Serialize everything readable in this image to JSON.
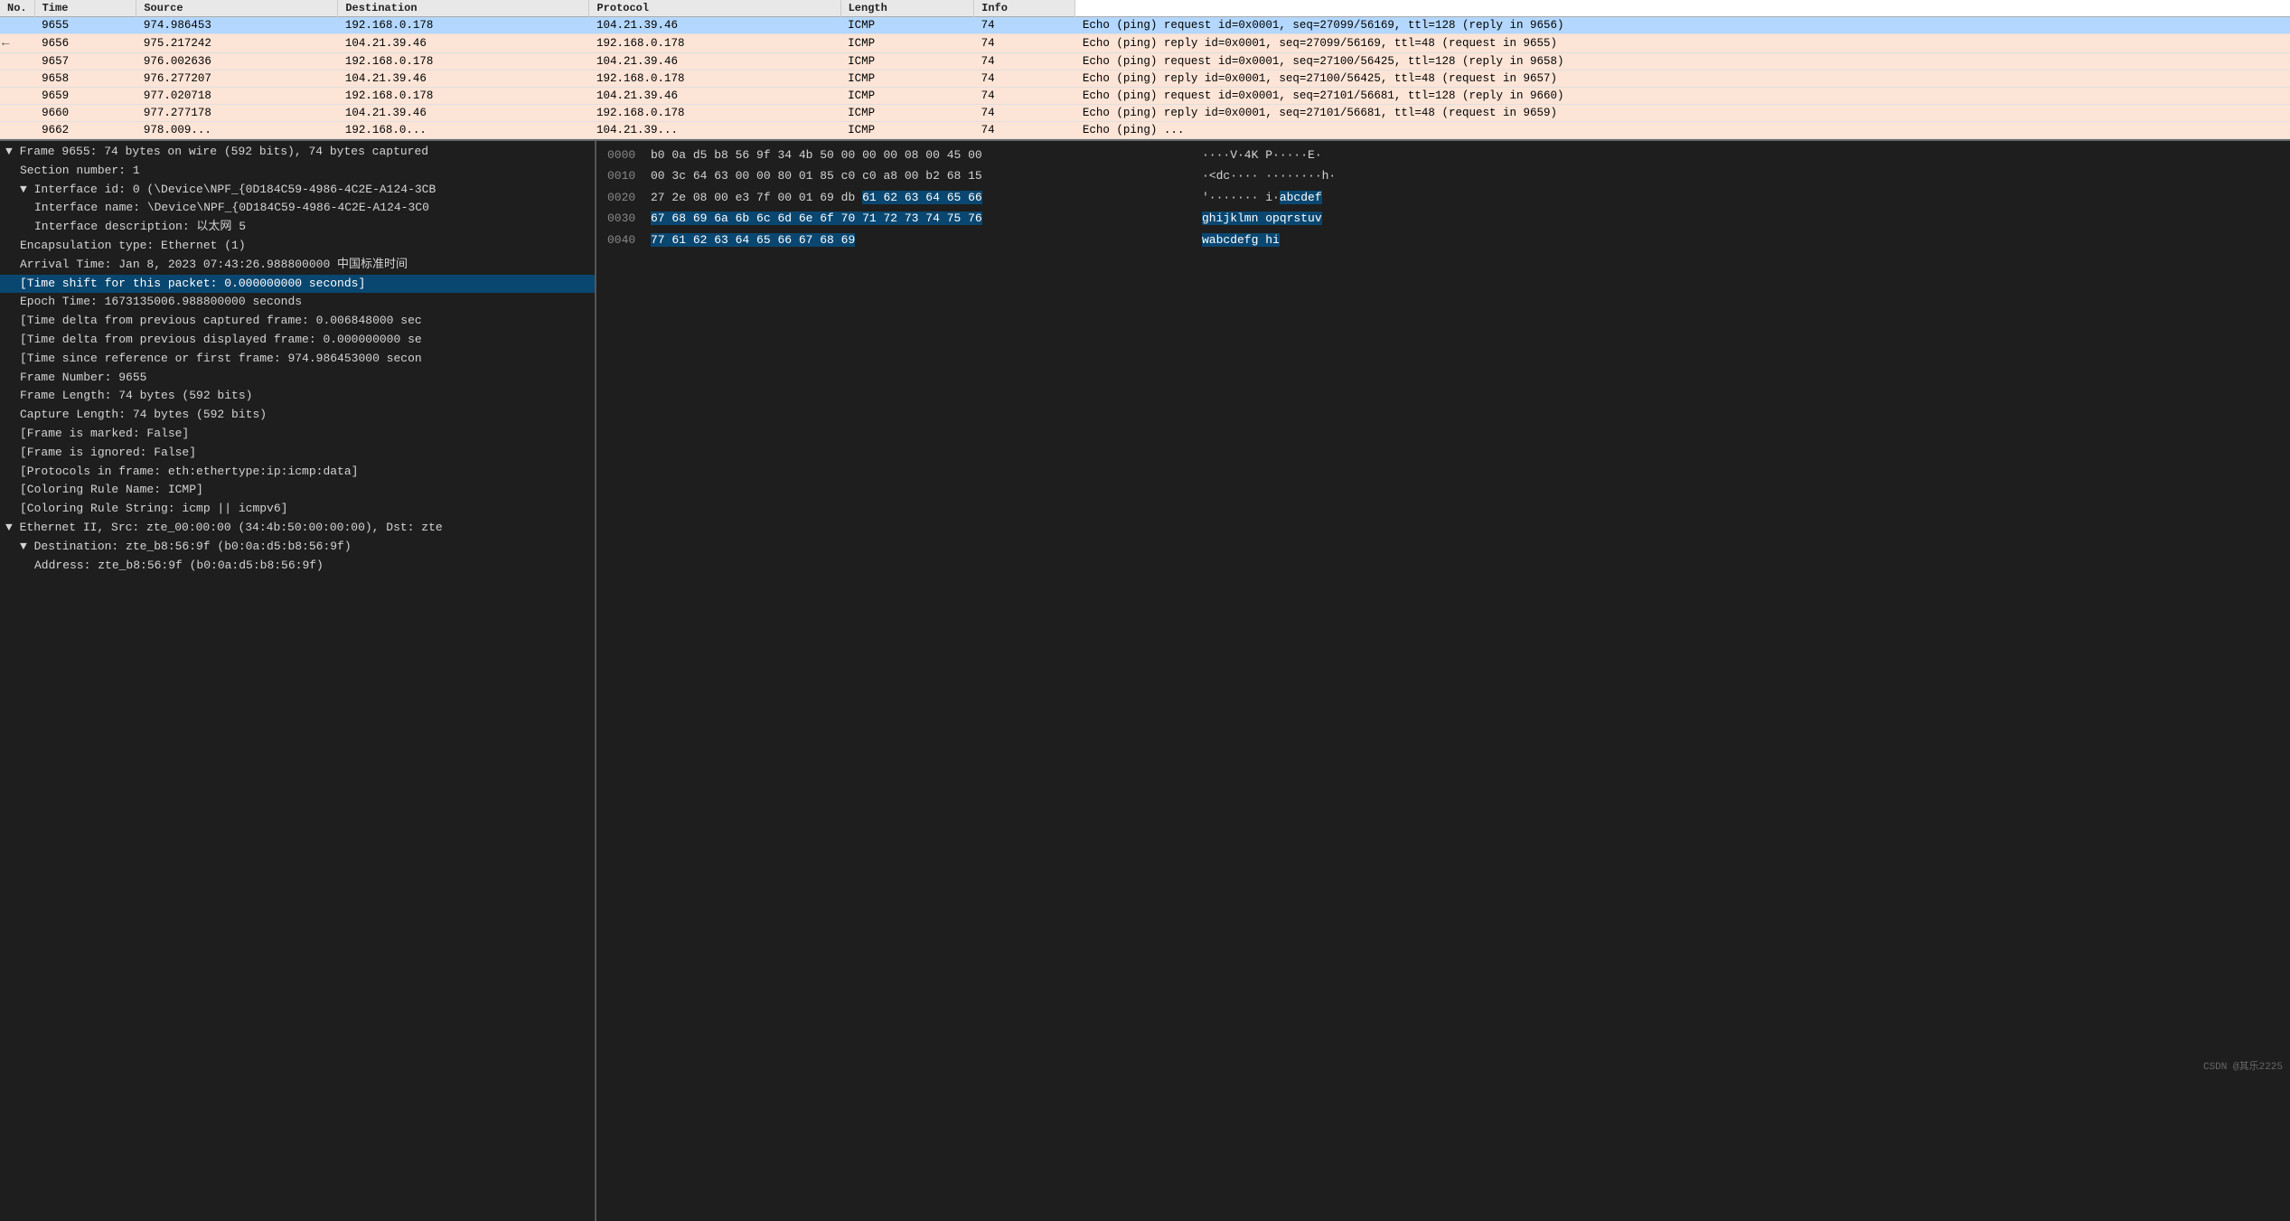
{
  "header": {
    "columns": [
      "No.",
      "Time",
      "Source",
      "Destination",
      "Protocol",
      "Length",
      "Info"
    ]
  },
  "packets": [
    {
      "no": "9655",
      "time": "974.986453",
      "src": "192.168.0.178",
      "dst": "104.21.39.46",
      "proto": "ICMP",
      "len": "74",
      "info": "Echo (ping) request   id=0x0001, seq=27099/56169, ttl=128 (reply in 9656)",
      "type": "request",
      "arrow": "",
      "selected": true
    },
    {
      "no": "9656",
      "time": "975.217242",
      "src": "104.21.39.46",
      "dst": "192.168.0.178",
      "proto": "ICMP",
      "len": "74",
      "info": "Echo (ping) reply     id=0x0001, seq=27099/56169, ttl=48 (request in 9655)",
      "type": "reply",
      "arrow": "←"
    },
    {
      "no": "9657",
      "time": "976.002636",
      "src": "192.168.0.178",
      "dst": "104.21.39.46",
      "proto": "ICMP",
      "len": "74",
      "info": "Echo (ping) request   id=0x0001, seq=27100/56425, ttl=128 (reply in 9658)",
      "type": "request",
      "arrow": ""
    },
    {
      "no": "9658",
      "time": "976.277207",
      "src": "104.21.39.46",
      "dst": "192.168.0.178",
      "proto": "ICMP",
      "len": "74",
      "info": "Echo (ping) reply     id=0x0001, seq=27100/56425, ttl=48 (request in 9657)",
      "type": "reply",
      "arrow": ""
    },
    {
      "no": "9659",
      "time": "977.020718",
      "src": "192.168.0.178",
      "dst": "104.21.39.46",
      "proto": "ICMP",
      "len": "74",
      "info": "Echo (ping) request   id=0x0001, seq=27101/56681, ttl=128 (reply in 9660)",
      "type": "request",
      "arrow": ""
    },
    {
      "no": "9660",
      "time": "977.277178",
      "src": "104.21.39.46",
      "dst": "192.168.0.178",
      "proto": "ICMP",
      "len": "74",
      "info": "Echo (ping) reply     id=0x0001, seq=27101/56681, ttl=48 (request in 9659)",
      "type": "reply",
      "arrow": ""
    },
    {
      "no": "9662",
      "time": "978.009...",
      "src": "192.168.0...",
      "dst": "104.21.39...",
      "proto": "ICMP",
      "len": "74",
      "info": "Echo (ping) ...",
      "type": "partial",
      "arrow": ""
    }
  ],
  "detail_lines": [
    {
      "indent": 0,
      "text": "▼ Frame 9655: 74 bytes on wire (592 bits), 74 bytes captured",
      "active": false
    },
    {
      "indent": 1,
      "text": "Section number: 1",
      "active": false
    },
    {
      "indent": 1,
      "text": "▼ Interface id: 0 (\\Device\\NPF_{0D184C59-4986-4C2E-A124-3CB",
      "active": false
    },
    {
      "indent": 2,
      "text": "Interface name: \\Device\\NPF_{0D184C59-4986-4C2E-A124-3C0",
      "active": false
    },
    {
      "indent": 2,
      "text": "Interface description: 以太网 5",
      "active": false
    },
    {
      "indent": 1,
      "text": "Encapsulation type: Ethernet (1)",
      "active": false
    },
    {
      "indent": 1,
      "text": "Arrival Time: Jan  8, 2023 07:43:26.988800000 中国标准时间",
      "active": false
    },
    {
      "indent": 1,
      "text": "[Time shift for this packet: 0.000000000 seconds]",
      "active": true
    },
    {
      "indent": 1,
      "text": "Epoch Time: 1673135006.988800000 seconds",
      "active": false
    },
    {
      "indent": 1,
      "text": "[Time delta from previous captured frame: 0.006848000 sec",
      "active": false
    },
    {
      "indent": 1,
      "text": "[Time delta from previous displayed frame: 0.000000000 se",
      "active": false
    },
    {
      "indent": 1,
      "text": "[Time since reference or first frame: 974.986453000 secon",
      "active": false
    },
    {
      "indent": 1,
      "text": "Frame Number: 9655",
      "active": false
    },
    {
      "indent": 1,
      "text": "Frame Length: 74 bytes (592 bits)",
      "active": false
    },
    {
      "indent": 1,
      "text": "Capture Length: 74 bytes (592 bits)",
      "active": false
    },
    {
      "indent": 1,
      "text": "[Frame is marked: False]",
      "active": false
    },
    {
      "indent": 1,
      "text": "[Frame is ignored: False]",
      "active": false
    },
    {
      "indent": 1,
      "text": "[Protocols in frame: eth:ethertype:ip:icmp:data]",
      "active": false
    },
    {
      "indent": 1,
      "text": "[Coloring Rule Name: ICMP]",
      "active": false
    },
    {
      "indent": 1,
      "text": "[Coloring Rule String: icmp || icmpv6]",
      "active": false
    },
    {
      "indent": 0,
      "text": "▼ Ethernet II, Src: zte_00:00:00 (34:4b:50:00:00:00), Dst: zte",
      "active": false
    },
    {
      "indent": 1,
      "text": "▼ Destination: zte_b8:56:9f (b0:0a:d5:b8:56:9f)",
      "active": false
    },
    {
      "indent": 2,
      "text": "Address: zte_b8:56:9f (b0:0a:d5:b8:56:9f)",
      "active": false
    }
  ],
  "hex_rows": [
    {
      "offset": "0000",
      "bytes_raw": "b0 0a d5 b8 56 9f 34 4b  50 00 00 00 08 00 45 00",
      "bytes": [
        {
          "val": "b0",
          "hl": false
        },
        {
          "val": "0a",
          "hl": false
        },
        {
          "val": "d5",
          "hl": false
        },
        {
          "val": "b8",
          "hl": false
        },
        {
          "val": "56",
          "hl": false
        },
        {
          "val": "9f",
          "hl": false
        },
        {
          "val": "34",
          "hl": false
        },
        {
          "val": "4b",
          "hl": false
        },
        {
          "val": "50",
          "hl": false
        },
        {
          "val": "00",
          "hl": false
        },
        {
          "val": "00",
          "hl": false
        },
        {
          "val": "00",
          "hl": false
        },
        {
          "val": "08",
          "hl": false
        },
        {
          "val": "00",
          "hl": false
        },
        {
          "val": "45",
          "hl": false
        },
        {
          "val": "00",
          "hl": false
        }
      ],
      "ascii": "····V·4K P·····E·",
      "ascii_hl": [
        false,
        false,
        false,
        false,
        false,
        false,
        false,
        false,
        false,
        false,
        false,
        false,
        false,
        false,
        false,
        false
      ]
    },
    {
      "offset": "0010",
      "bytes": [
        {
          "val": "00",
          "hl": false
        },
        {
          "val": "3c",
          "hl": false
        },
        {
          "val": "64",
          "hl": false
        },
        {
          "val": "63",
          "hl": false
        },
        {
          "val": "00",
          "hl": false
        },
        {
          "val": "00",
          "hl": false
        },
        {
          "val": "80",
          "hl": false
        },
        {
          "val": "01",
          "hl": false
        },
        {
          "val": "85",
          "hl": false
        },
        {
          "val": "c0",
          "hl": false
        },
        {
          "val": "c0",
          "hl": false
        },
        {
          "val": "a8",
          "hl": false
        },
        {
          "val": "00",
          "hl": false
        },
        {
          "val": "b2",
          "hl": false
        },
        {
          "val": "68",
          "hl": false
        },
        {
          "val": "15",
          "hl": false
        }
      ],
      "ascii": "·<dc····  ········h·",
      "ascii_hl": [
        false,
        false,
        false,
        false,
        false,
        false,
        false,
        false,
        false,
        false,
        false,
        false,
        false,
        false,
        false,
        false
      ]
    },
    {
      "offset": "0020",
      "bytes": [
        {
          "val": "27",
          "hl": false
        },
        {
          "val": "2e",
          "hl": false
        },
        {
          "val": "08",
          "hl": false
        },
        {
          "val": "00",
          "hl": false
        },
        {
          "val": "e3",
          "hl": false
        },
        {
          "val": "7f",
          "hl": false
        },
        {
          "val": "00",
          "hl": false
        },
        {
          "val": "01",
          "hl": false
        },
        {
          "val": "69",
          "hl": false
        },
        {
          "val": "db",
          "hl": false
        },
        {
          "val": "61",
          "hl": true
        },
        {
          "val": "62",
          "hl": true
        },
        {
          "val": "63",
          "hl": true
        },
        {
          "val": "64",
          "hl": true
        },
        {
          "val": "65",
          "hl": true
        },
        {
          "val": "66",
          "hl": true
        }
      ],
      "ascii_parts": [
        {
          "text": "'·······  i·",
          "hl": false
        },
        {
          "text": "abcdef",
          "hl": true
        }
      ]
    },
    {
      "offset": "0030",
      "bytes": [
        {
          "val": "67",
          "hl": true
        },
        {
          "val": "68",
          "hl": true
        },
        {
          "val": "69",
          "hl": true
        },
        {
          "val": "6a",
          "hl": true
        },
        {
          "val": "6b",
          "hl": true
        },
        {
          "val": "6c",
          "hl": true
        },
        {
          "val": "6d",
          "hl": true
        },
        {
          "val": "6e",
          "hl": true
        },
        {
          "val": "6f",
          "hl": true
        },
        {
          "val": "70",
          "hl": true
        },
        {
          "val": "71",
          "hl": true
        },
        {
          "val": "72",
          "hl": true
        },
        {
          "val": "73",
          "hl": true
        },
        {
          "val": "74",
          "hl": true
        },
        {
          "val": "75",
          "hl": true
        },
        {
          "val": "76",
          "hl": true
        }
      ],
      "ascii_parts": [
        {
          "text": "ghijklmn opqrstuv",
          "hl": true
        }
      ]
    },
    {
      "offset": "0040",
      "bytes": [
        {
          "val": "77",
          "hl": true
        },
        {
          "val": "61",
          "hl": true
        },
        {
          "val": "62",
          "hl": true
        },
        {
          "val": "63",
          "hl": true
        },
        {
          "val": "64",
          "hl": true
        },
        {
          "val": "65",
          "hl": true
        },
        {
          "val": "66",
          "hl": true
        },
        {
          "val": "67",
          "hl": true
        },
        {
          "val": "68",
          "hl": true
        },
        {
          "val": "69",
          "hl": true
        }
      ],
      "ascii_parts": [
        {
          "text": "wabcdefg hi",
          "hl": true
        }
      ]
    }
  ],
  "watermark": "CSDN @其乐2225"
}
